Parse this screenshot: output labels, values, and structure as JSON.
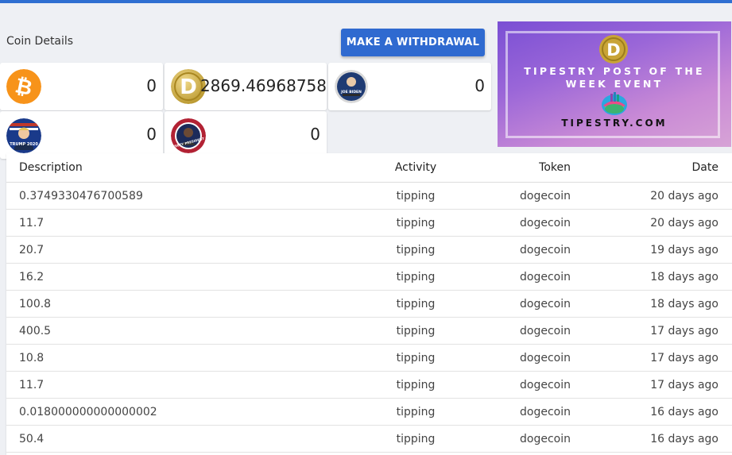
{
  "page": {
    "title": "Coin Details"
  },
  "actions": {
    "withdraw_label": "MAKE A WITHDRAWAL"
  },
  "coins": [
    {
      "name": "bitcoin",
      "icon": "bitcoin-icon",
      "amount": "0",
      "color": "#f7931a"
    },
    {
      "name": "dogecoin",
      "icon": "dogecoin-icon",
      "amount": "2869.46968758",
      "color": "#c2a633"
    },
    {
      "name": "joe-biden",
      "icon": "joe-biden-coin-icon",
      "amount": "0",
      "color": "#1f3b73",
      "logo_text": "JOE BIDEN"
    },
    {
      "name": "trump",
      "icon": "trump-coin-icon",
      "amount": "0",
      "color": "#1a3a8a",
      "logo_text": "TRUMP 2020"
    },
    {
      "name": "kanye",
      "icon": "yeezy-president-coin-icon",
      "amount": "0",
      "color": "#b22234",
      "logo_text": "YEEZY PRESIDENT"
    }
  ],
  "banner": {
    "title_line1": "TIPESTRY POST OF THE",
    "title_line2": "WEEK EVENT",
    "url": "TIPESTRY.COM"
  },
  "table": {
    "headers": {
      "description": "Description",
      "activity": "Activity",
      "token": "Token",
      "date": "Date"
    },
    "rows": [
      {
        "description": "0.3749330476700589",
        "activity": "tipping",
        "token": "dogecoin",
        "date": "20 days ago"
      },
      {
        "description": "11.7",
        "activity": "tipping",
        "token": "dogecoin",
        "date": "20 days ago"
      },
      {
        "description": "20.7",
        "activity": "tipping",
        "token": "dogecoin",
        "date": "19 days ago"
      },
      {
        "description": "16.2",
        "activity": "tipping",
        "token": "dogecoin",
        "date": "18 days ago"
      },
      {
        "description": "100.8",
        "activity": "tipping",
        "token": "dogecoin",
        "date": "18 days ago"
      },
      {
        "description": "400.5",
        "activity": "tipping",
        "token": "dogecoin",
        "date": "17 days ago"
      },
      {
        "description": "10.8",
        "activity": "tipping",
        "token": "dogecoin",
        "date": "17 days ago"
      },
      {
        "description": "11.7",
        "activity": "tipping",
        "token": "dogecoin",
        "date": "17 days ago"
      },
      {
        "description": "0.018000000000000002",
        "activity": "tipping",
        "token": "dogecoin",
        "date": "16 days ago"
      },
      {
        "description": "50.4",
        "activity": "tipping",
        "token": "dogecoin",
        "date": "16 days ago"
      }
    ]
  }
}
